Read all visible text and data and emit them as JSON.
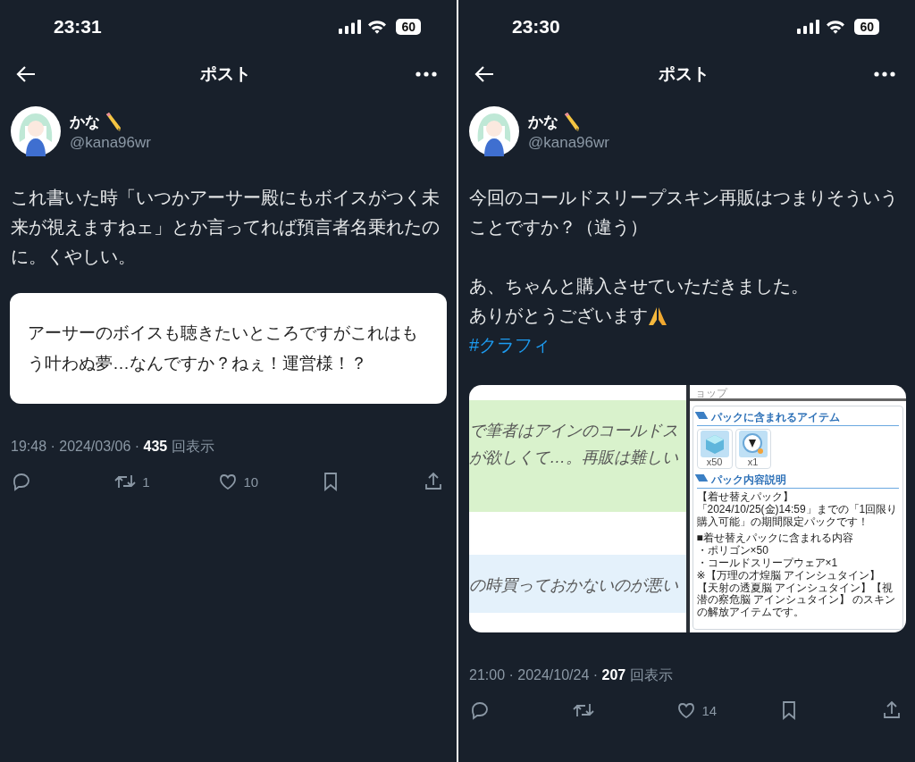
{
  "screens": [
    {
      "status_bar": {
        "time": "23:31",
        "battery": "60"
      },
      "header": {
        "title": "ポスト"
      },
      "author": {
        "name": "かな",
        "name_icon": true,
        "handle": "@kana96wr"
      },
      "body": [
        {
          "kind": "line",
          "text": "これ書いた時「いつかアーサー殿にもボイスがつく未来が視えますねェ」とか言ってれば預言者名乗れたのに。くやしい。"
        }
      ],
      "quote": {
        "text": "アーサーのボイスも聴きたいところですがこれはもう叶わぬ夢…なんですか？ねぇ！運営様！？"
      },
      "meta": {
        "line": "19:48 · 2024/03/06 · **435** 回表示"
      },
      "actions": [
        {
          "kind": "reply"
        },
        {
          "kind": "repost",
          "count": "1"
        },
        {
          "kind": "like",
          "count": "10"
        },
        {
          "kind": "bookmark"
        },
        {
          "kind": "share"
        }
      ]
    },
    {
      "status_bar": {
        "time": "23:30",
        "battery": "60"
      },
      "header": {
        "title": "ポスト"
      },
      "author": {
        "name": "かな",
        "name_icon": true,
        "handle": "@kana96wr"
      },
      "body": [
        {
          "kind": "line",
          "text": "今回のコールドスリープスキン再販はつまりそういうことですか？（違う）"
        },
        {
          "kind": "blank"
        },
        {
          "kind": "line",
          "text": "あ、ちゃんと購入させていただきました。"
        },
        {
          "kind": "line",
          "text": "ありがとうございます",
          "trailing_icon": true
        },
        {
          "kind": "hashtag",
          "text": "#クラフィ"
        }
      ],
      "attachment": {
        "left": {
          "bands": [
            {
              "color": "#d9f2cc",
              "lines": [
                "で筆者はアインのコールドス",
                "が欲しくて…。再販は難しい"
              ]
            },
            {
              "color": "#e4f1fb",
              "lines": [
                "の時買っておかないのが悪い"
              ]
            }
          ]
        },
        "right": {
          "header": "ョップ",
          "sections": [
            {
              "kind": "items",
              "title": "パックに含まれるアイテム",
              "items": [
                {
                  "kind": "cube",
                  "count": "x50"
                },
                {
                  "kind": "emblem",
                  "count": "x1"
                }
              ]
            },
            {
              "kind": "text",
              "title": "パック内容説明",
              "paragraphs": [
                [
                  "【着せ替えパック】",
                  "「2024/10/25(金)14:59」までの「1回限り購入可能」の期間限定パックです！"
                ],
                [
                  "■着せ替えパックに含まれる内容",
                  "・ポリゴン×50",
                  "・コールドスリープウェア×1",
                  "※【万理の才煌脳 アインシュタイン】【天射の透夏脳 アインシュタイン】【視潜の察危脳 アインシュタイン】 のスキンの解放アイテムです。"
                ]
              ]
            }
          ]
        }
      },
      "meta": {
        "line": "21:00 · 2024/10/24 · **207** 回表示"
      },
      "actions": [
        {
          "kind": "reply"
        },
        {
          "kind": "repost"
        },
        {
          "kind": "like",
          "count": "14"
        },
        {
          "kind": "bookmark"
        },
        {
          "kind": "share"
        }
      ]
    }
  ]
}
